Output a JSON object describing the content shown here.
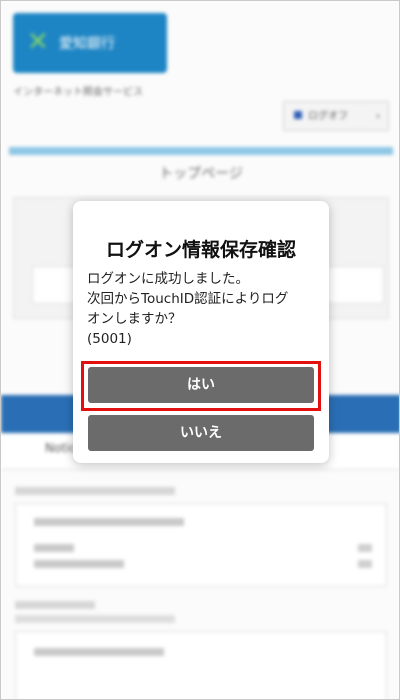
{
  "background": {
    "logo_text": "愛知銀行",
    "service_text": "インターネット照会サービス",
    "menu_label": "ログオフ",
    "page_title": "トップページ",
    "tab_label": "Notice"
  },
  "dialog": {
    "title": "ログオン情報保存確認",
    "message_lines": [
      "ログオンに成功しました。",
      "次回からTouchID認証によりログ",
      "オンしますか？",
      "(5001)"
    ],
    "yes_label": "はい",
    "no_label": "いいえ"
  },
  "colors": {
    "button": "#6b6b6b",
    "highlight": "#e31010",
    "brand": "#1e85c4"
  }
}
